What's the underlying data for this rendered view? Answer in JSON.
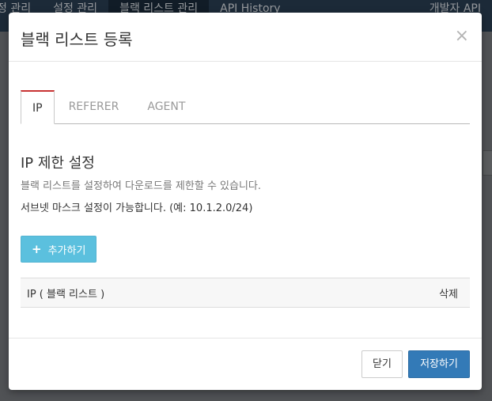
{
  "background_nav": {
    "items": [
      "정 관리",
      "설정 관리",
      "블랙 리스트 관리",
      "API History"
    ],
    "right_item": "개발자 API"
  },
  "modal": {
    "title": "블랙 리스트 등록",
    "close_symbol": "×",
    "tabs": [
      {
        "label": "IP",
        "active": true
      },
      {
        "label": "REFERER",
        "active": false
      },
      {
        "label": "AGENT",
        "active": false
      }
    ],
    "section_title": "IP 제한 설정",
    "description": "블랙 리스트를 설정하여 다운로드를 제한할 수 있습니다.",
    "subnet_note": "서브넷 마스크 설정이 가능합니다. (예: 10.1.2.0/24)",
    "add_button": {
      "icon": "plus-icon",
      "label": "추가하기"
    },
    "table": {
      "columns": [
        "IP ( 블랙 리스트 )",
        "삭제"
      ],
      "rows": []
    },
    "footer": {
      "close_label": "닫기",
      "save_label": "저장하기"
    }
  },
  "colors": {
    "tab_active_border": "#c83232",
    "add_button_bg": "#5bc0de",
    "save_button_bg": "#337ab7"
  }
}
